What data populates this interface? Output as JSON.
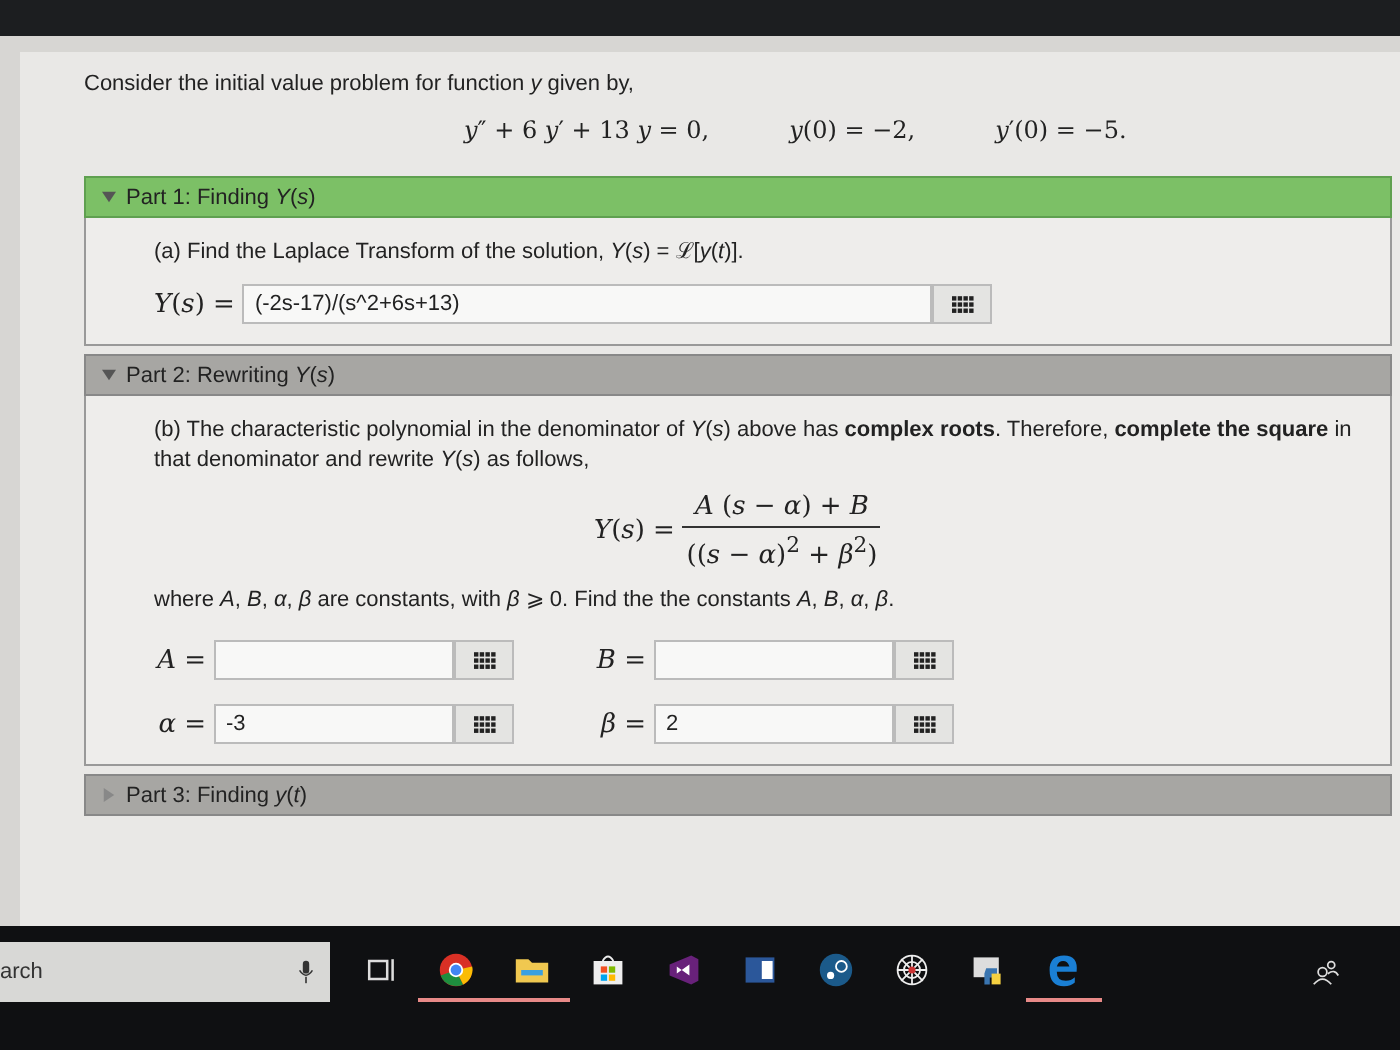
{
  "intro": "Consider the initial value problem for function *y* given by,",
  "equations": [
    "*y*″ + 6 *y*′ + 13 *y* = 0,",
    "*y*(0) = −2,",
    "*y*′(0) = −5."
  ],
  "parts": [
    {
      "label": "Part 1: Finding *Y*(*s*)",
      "expanded": true,
      "complete": true,
      "prompt": "(a) Find the Laplace Transform of the solution, *Y*(*s*) = ℒ[*y*(*t*)].",
      "answers": [
        {
          "label": "*Y*(*s*) =",
          "value": "(-2s-17)/(s^2+6s+13)"
        }
      ]
    },
    {
      "label": "Part 2: Rewriting *Y*(*s*)",
      "expanded": true,
      "complete": false,
      "prompt": "(b) The characteristic polynomial in the denominator of *Y*(*s*) above has **complex roots**. Therefore, **complete the square** in that denominator and rewrite *Y*(*s*) as follows,",
      "formula": {
        "lhs": "*Y*(*s*) =",
        "numerator": "*A* (*s* − *α*) + *B*",
        "denominator": "((*s* − *α*)$^{2}$ + *β*$^{2}$)"
      },
      "note": "where *A*, *B*, *α*, *β* are constants, with *β* ⩾ 0. Find the the constants *A*, *B*, *α*, *β*.",
      "answers": [
        {
          "label": "*A* ="
        },
        {
          "label": "*B* ="
        },
        {
          "label": "*α* =",
          "value": "-3"
        },
        {
          "label": "*β* =",
          "value": "2"
        }
      ]
    },
    {
      "label": "Part 3: Finding *y*(*t*)",
      "expanded": false,
      "complete": false
    }
  ],
  "taskbar": {
    "search": {
      "placeholder": "arch"
    },
    "items": [
      {
        "kind": "taskview",
        "running": false
      },
      {
        "kind": "chrome",
        "running": true
      },
      {
        "kind": "folder",
        "running": true
      },
      {
        "kind": "store",
        "running": false
      },
      {
        "kind": "vs",
        "running": false
      },
      {
        "kind": "word",
        "running": false
      },
      {
        "kind": "steam",
        "running": false
      },
      {
        "kind": "web",
        "running": false
      },
      {
        "kind": "python",
        "running": false
      },
      {
        "kind": "edge",
        "running": true
      }
    ]
  }
}
